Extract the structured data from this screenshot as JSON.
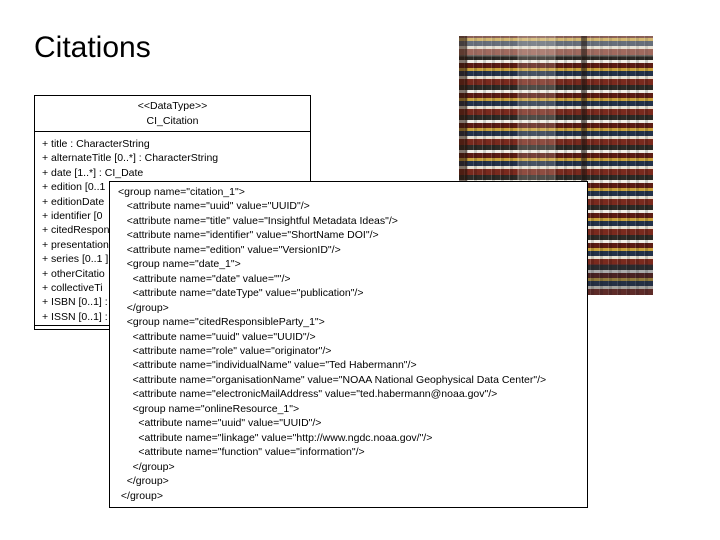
{
  "slide": {
    "title": "Citations"
  },
  "uml": {
    "stereotype": "<<DataType>>",
    "class_name": "CI_Citation",
    "attributes": [
      "+ title : CharacterString",
      "+ alternateTitle [0..*] : CharacterString",
      "+ date [1..*] : CI_Date",
      "+ edition [0..1",
      "+ editionDate",
      "+ identifier [0",
      "+ citedRespon",
      "+ presentation",
      "+ series [0..1 ]",
      "+ otherCitatio",
      "+ collectiveTi",
      "+ ISBN [0..1] :",
      "+ ISSN [0..1] :"
    ]
  },
  "photo": {
    "description": "stacks of books on shelves"
  },
  "xml": {
    "lines": [
      "<group name=\"citation_1\">",
      "   <attribute name=\"uuid\" value=\"UUID\"/>",
      "   <attribute name=\"title\" value=\"Insightful Metadata Ideas\"/>",
      "   <attribute name=\"identifier\" value=\"ShortName DOI\"/>",
      "   <attribute name=\"edition\" value=\"VersionID\"/>",
      "   <group name=\"date_1\">",
      "     <attribute name=\"date\" value=\"\"/>",
      "     <attribute name=\"dateType\" value=\"publication\"/>",
      "   </group>",
      "   <group name=\"citedResponsibleParty_1\">",
      "     <attribute name=\"uuid\" value=\"UUID\"/>",
      "     <attribute name=\"role\" value=\"originator\"/>",
      "     <attribute name=\"individualName\" value=\"Ted Habermann\"/>",
      "     <attribute name=\"organisationName\" value=\"NOAA National Geophysical Data Center\"/>",
      "     <attribute name=\"electronicMailAddress\" value=\"ted.habermann@noaa.gov\"/>",
      "     <group name=\"onlineResource_1\">",
      "       <attribute name=\"uuid\" value=\"UUID\"/>",
      "       <attribute name=\"linkage\" value=\"http://www.ngdc.noaa.gov/\"/>",
      "       <attribute name=\"function\" value=\"information\"/>",
      "     </group>",
      "   </group>",
      " </group>"
    ]
  }
}
